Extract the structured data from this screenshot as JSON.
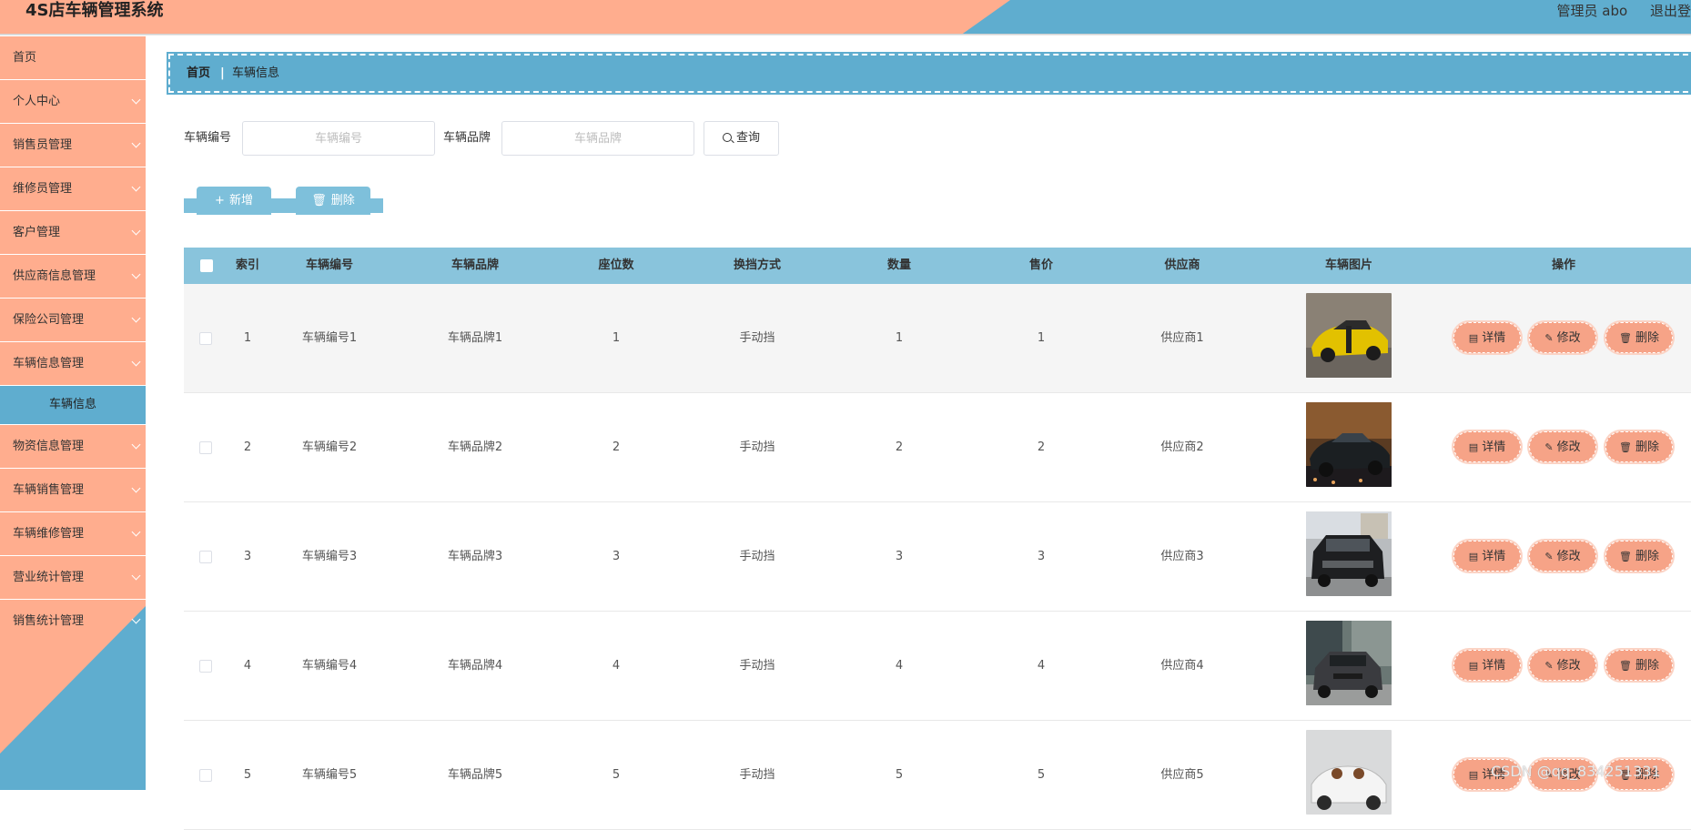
{
  "header": {
    "title": "4S店车辆管理系统",
    "user_label": "管理员 abo",
    "logout_label": "退出登"
  },
  "sidebar": {
    "items": [
      {
        "label": "首页"
      },
      {
        "label": "个人中心"
      },
      {
        "label": "销售员管理"
      },
      {
        "label": "维修员管理"
      },
      {
        "label": "客户管理"
      },
      {
        "label": "供应商信息管理"
      },
      {
        "label": "保险公司管理"
      },
      {
        "label": "车辆信息管理"
      },
      {
        "label": "车辆信息"
      },
      {
        "label": "物资信息管理"
      },
      {
        "label": "车辆销售管理"
      },
      {
        "label": "车辆维修管理"
      },
      {
        "label": "营业统计管理"
      },
      {
        "label": "销售统计管理"
      }
    ]
  },
  "breadcrumb": {
    "home": "首页",
    "separator": "|",
    "current": "车辆信息"
  },
  "search": {
    "field1_label": "车辆编号",
    "field1_placeholder": "车辆编号",
    "field2_label": "车辆品牌",
    "field2_placeholder": "车辆品牌",
    "query_label": "查询"
  },
  "toolbar": {
    "add_label": "新增",
    "delete_label": "删除"
  },
  "table": {
    "headers": [
      "索引",
      "车辆编号",
      "车辆品牌",
      "座位数",
      "换挡方式",
      "数量",
      "售价",
      "供应商",
      "车辆图片",
      "操作"
    ],
    "action_labels": {
      "detail": "详情",
      "edit": "修改",
      "delete": "删除"
    },
    "rows": [
      {
        "index": "1",
        "code": "车辆编号1",
        "brand": "车辆品牌1",
        "seats": "1",
        "gear": "手动挡",
        "qty": "1",
        "price": "1",
        "supplier": "供应商1",
        "img": "yellow-sports-car"
      },
      {
        "index": "2",
        "code": "车辆编号2",
        "brand": "车辆品牌2",
        "seats": "2",
        "gear": "手动挡",
        "qty": "2",
        "price": "2",
        "supplier": "供应商2",
        "img": "dark-sports-car-night"
      },
      {
        "index": "3",
        "code": "车辆编号3",
        "brand": "车辆品牌3",
        "seats": "3",
        "gear": "手动挡",
        "qty": "3",
        "price": "3",
        "supplier": "供应商3",
        "img": "black-suv"
      },
      {
        "index": "4",
        "code": "车辆编号4",
        "brand": "车辆品牌4",
        "seats": "4",
        "gear": "手动挡",
        "qty": "4",
        "price": "4",
        "supplier": "供应商4",
        "img": "grey-hatchback"
      },
      {
        "index": "5",
        "code": "车辆编号5",
        "brand": "车辆品牌5",
        "seats": "5",
        "gear": "手动挡",
        "qty": "5",
        "price": "5",
        "supplier": "供应商5",
        "img": "white-roadster"
      }
    ]
  },
  "watermark": "CSDN @qq_834251331",
  "colors": {
    "accent_orange": "#ffad8e",
    "accent_blue": "#5fadcf",
    "header_row": "#89c4dc",
    "action_button": "#f6a387"
  }
}
